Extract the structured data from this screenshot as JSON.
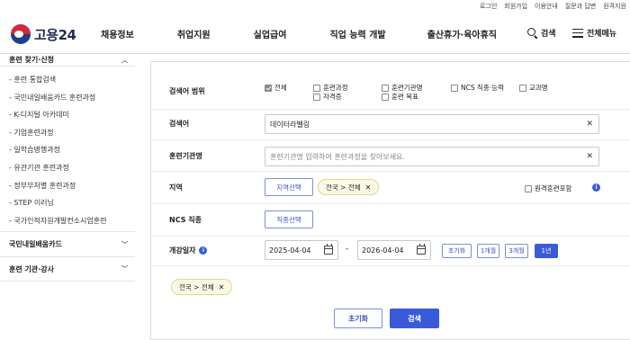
{
  "util_links": [
    "로그인",
    "회원가입",
    "이용안내",
    "질문과 답변",
    "원격지원"
  ],
  "logo": {
    "text": "고용24"
  },
  "gnb": [
    "채용정보",
    "취업지원",
    "실업급여",
    "직업 능력 개발",
    "출산휴가·육아휴직"
  ],
  "header": {
    "search_label": "검색",
    "menu_label": "전체메뉴"
  },
  "sidebar": {
    "title": "훈련 찾기·신청",
    "items": [
      "- 훈련 통합검색",
      "- 국민내일배움카드 훈련과정",
      "- K-디지털 아카데미",
      "- 기업훈련과정",
      "- 일학습병행과정",
      "- 유관기관 훈련과정",
      "- 정부부처별 훈련과정",
      "- STEP 이러닝",
      "- 국가인적자원개발컨소시엄훈련"
    ],
    "sections": [
      "국민내일배움카드",
      "훈련 기관·강사"
    ]
  },
  "form": {
    "scope_label": "검색어 범위",
    "scope_options": [
      {
        "label": "전체",
        "checked": true
      },
      {
        "label": "훈련과정",
        "checked": false
      },
      {
        "label": "훈련기관명",
        "checked": false
      },
      {
        "label": "NCS 직종·능력",
        "checked": false
      },
      {
        "label": "교과명",
        "checked": false
      },
      {
        "label": "자격증",
        "checked": false
      },
      {
        "label": "훈련 목표",
        "checked": false
      }
    ],
    "keyword_label": "검색어",
    "keyword_value": "데이터라벨링",
    "org_label": "훈련기관명",
    "org_placeholder": "훈련기관명 입력하여 훈련과정을 찾아보세요.",
    "region_label": "지역",
    "region_button": "지역선택",
    "region_chip": "전국 > 전체",
    "remote_label": "원격훈련포함",
    "ncs_label": "NCS 직종",
    "ncs_button": "직종선택",
    "date_label": "개강일자",
    "date_from": "2025-04-04",
    "date_separator": "-",
    "date_to": "2026-04-04",
    "periods": [
      "초기화",
      "1개월",
      "3개월",
      "1년"
    ],
    "active_period": "1년",
    "selected_chip": "전국 > 전체",
    "reset_button": "초기화",
    "search_button": "검색"
  }
}
